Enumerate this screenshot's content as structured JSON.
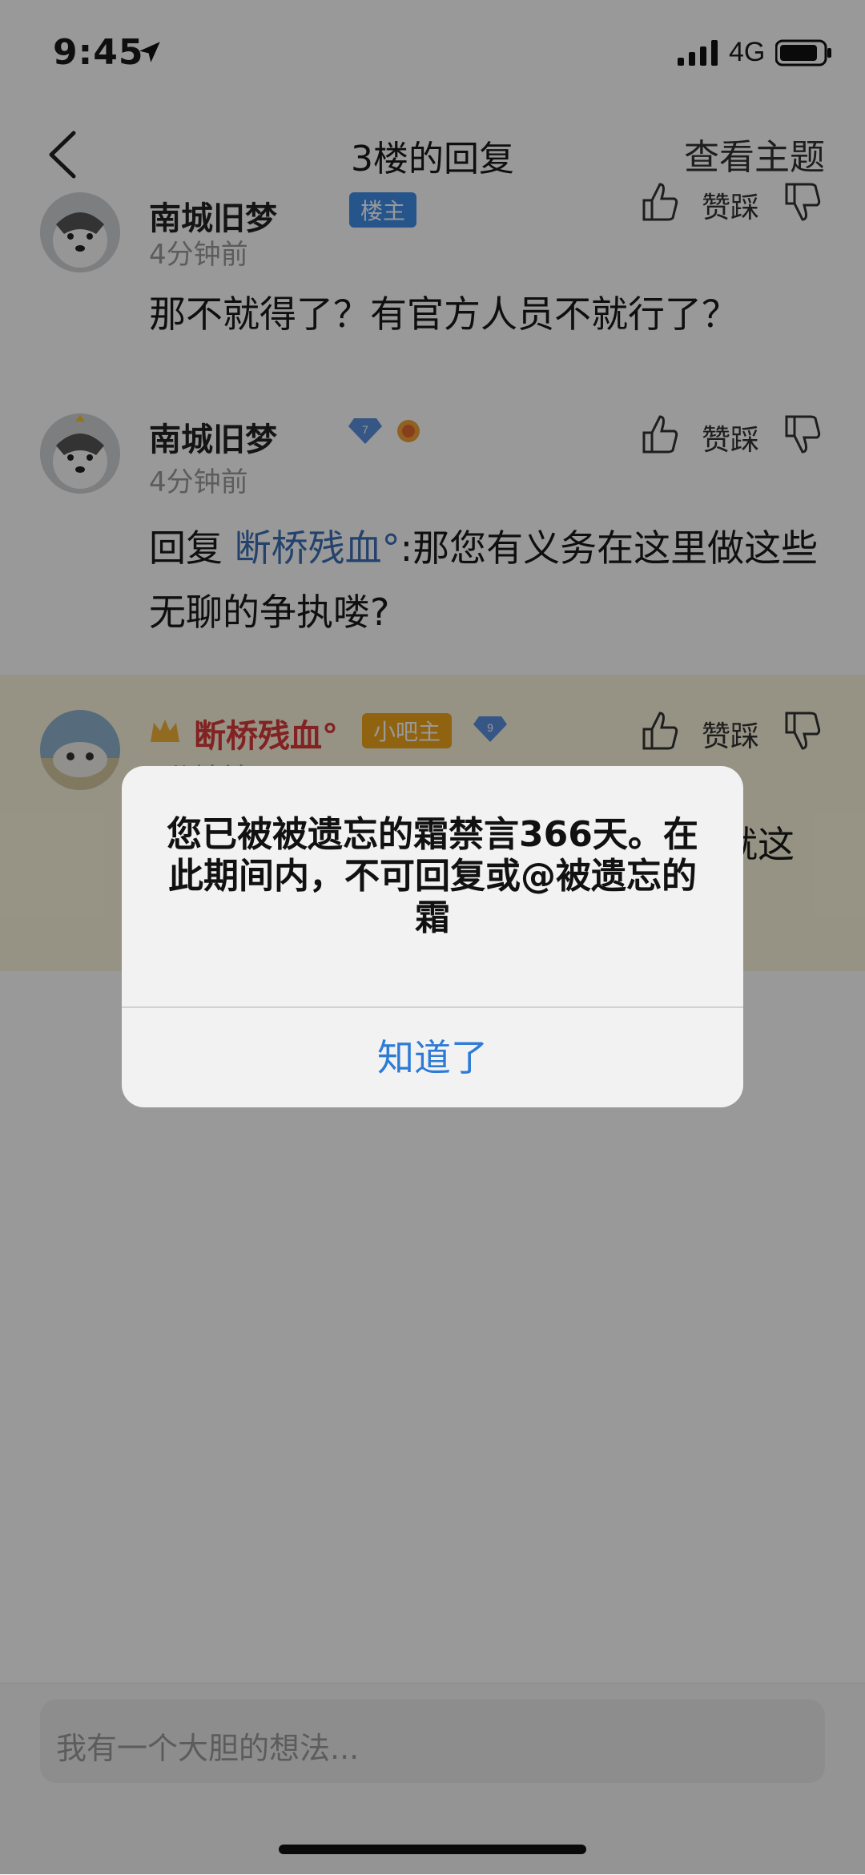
{
  "status_bar": {
    "time": "9:45",
    "network": "4G"
  },
  "nav": {
    "title": "3楼的回复",
    "action": "查看主题"
  },
  "comments": [
    {
      "username": "南城旧梦",
      "badge": "楼主",
      "time": "4分钟前",
      "text": "那不就得了？有官方人员不就行了？",
      "like_label": "赞踩"
    },
    {
      "username": "南城旧梦",
      "level": "7",
      "time": "4分钟前",
      "reply_prefix": "回复",
      "mention": "断桥残血°",
      "text": ":那您有义务在这里做这些无聊的争执喽?",
      "like_label": "赞踩"
    },
    {
      "username": "断桥残血°",
      "badge": "小吧主",
      "level": "9",
      "time": "3分钟前",
      "text": "就这",
      "like_label": "赞踩"
    }
  ],
  "reply_input": {
    "placeholder": "我有一个大胆的想法..."
  },
  "alert": {
    "message": "您已被被遗忘的霜禁言366天。在此期间内，不可回复或@被遗忘的霜",
    "button": "知道了"
  },
  "colors": {
    "accent": "#2e7bd6",
    "mention": "#3b6fb6",
    "highlight_bg": "#fbf6de",
    "admin_name": "#d93a3a"
  }
}
